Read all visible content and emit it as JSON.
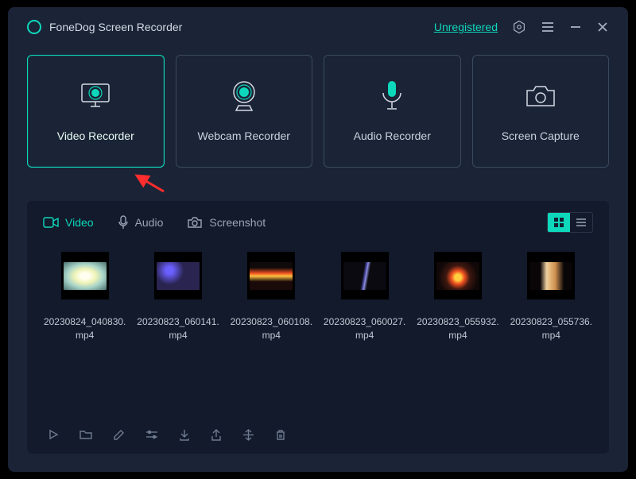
{
  "app": {
    "title": "FoneDog Screen Recorder",
    "status": "Unregistered"
  },
  "modes": [
    {
      "id": "video",
      "label": "Video Recorder",
      "active": true
    },
    {
      "id": "webcam",
      "label": "Webcam Recorder",
      "active": false
    },
    {
      "id": "audio",
      "label": "Audio Recorder",
      "active": false
    },
    {
      "id": "capture",
      "label": "Screen Capture",
      "active": false
    }
  ],
  "tabs": [
    {
      "id": "video",
      "label": "Video",
      "active": true
    },
    {
      "id": "audio",
      "label": "Audio",
      "active": false
    },
    {
      "id": "screenshot",
      "label": "Screenshot",
      "active": false
    }
  ],
  "files": [
    {
      "name": "20230824_040830.mp4",
      "thumb": "th1"
    },
    {
      "name": "20230823_060141.mp4",
      "thumb": "th2"
    },
    {
      "name": "20230823_060108.mp4",
      "thumb": "th3"
    },
    {
      "name": "20230823_060027.mp4",
      "thumb": "th4"
    },
    {
      "name": "20230823_055932.mp4",
      "thumb": "th5"
    },
    {
      "name": "20230823_055736.mp4",
      "thumb": "th6"
    }
  ],
  "accent": "#0ed8bb"
}
